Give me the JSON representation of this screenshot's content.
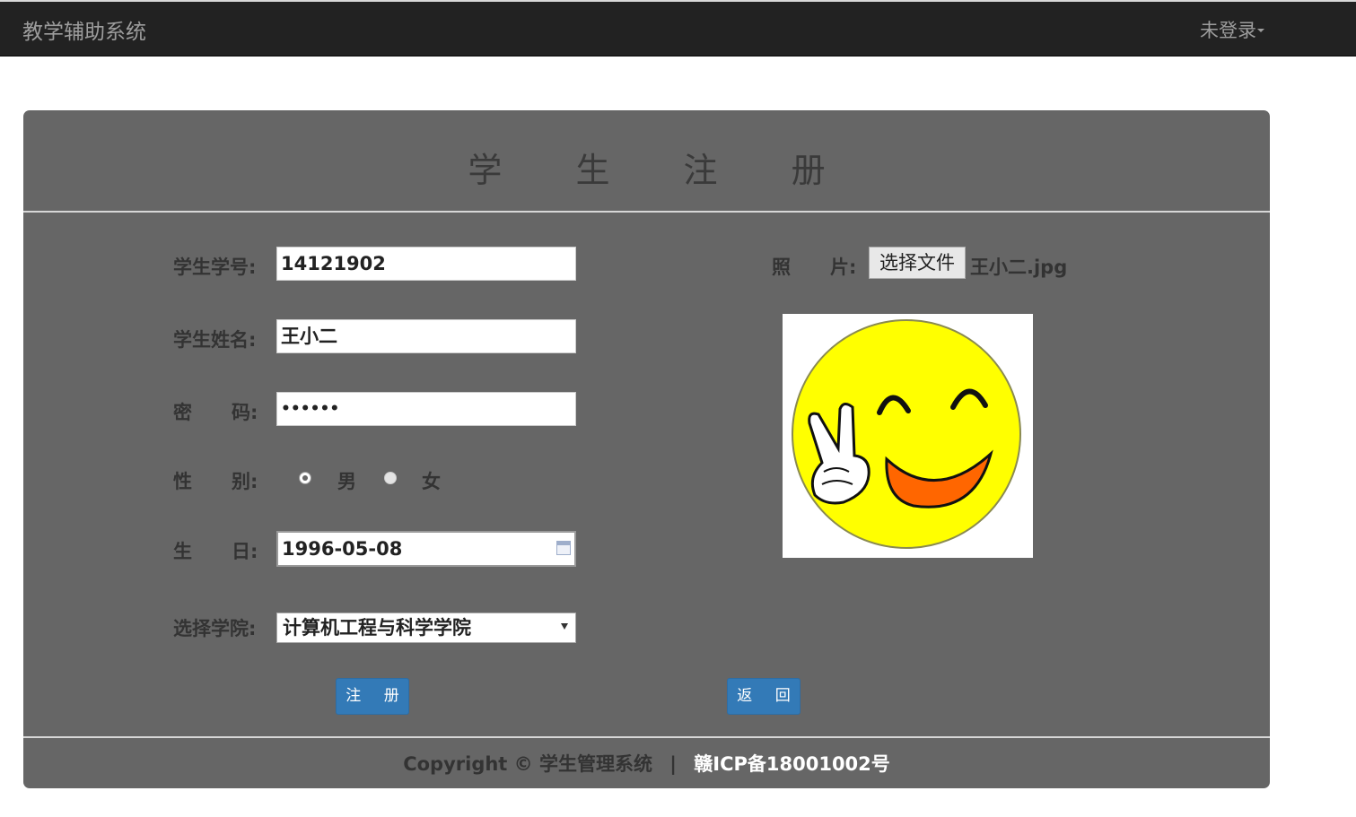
{
  "navbar": {
    "brand": "教学辅助系统",
    "login_menu": "未登录"
  },
  "form": {
    "title": "学 生 注 册",
    "student_id": {
      "label": "学生学号:",
      "value": "14121902"
    },
    "student_name": {
      "label": "学生姓名:",
      "value": "王小二"
    },
    "password": {
      "label_left": "密",
      "label_right": "码:",
      "value": "••••••"
    },
    "gender": {
      "label_left": "性",
      "label_right": "别:",
      "options": [
        "男",
        "女"
      ],
      "selected": "男"
    },
    "birthday": {
      "label_left": "生",
      "label_right": "日:",
      "value": "1996-05-08"
    },
    "college": {
      "label": "选择学院:",
      "value": "计算机工程与科学学院"
    },
    "photo": {
      "label_left": "照",
      "label_right": "片:",
      "choose_button": "选择文件",
      "file_name": "王小二.jpg"
    },
    "submit_button": "注 册",
    "back_button": "返 回"
  },
  "footer": {
    "copyright": "Copyright © 学生管理系统",
    "separator": "|",
    "icp": "赣ICP备18001002号"
  },
  "colors": {
    "navbar": "#222222",
    "panel": "#666666",
    "primary_button": "#337ab7",
    "smiley_face": "#ffff00",
    "smiley_mouth": "#ff6600"
  }
}
